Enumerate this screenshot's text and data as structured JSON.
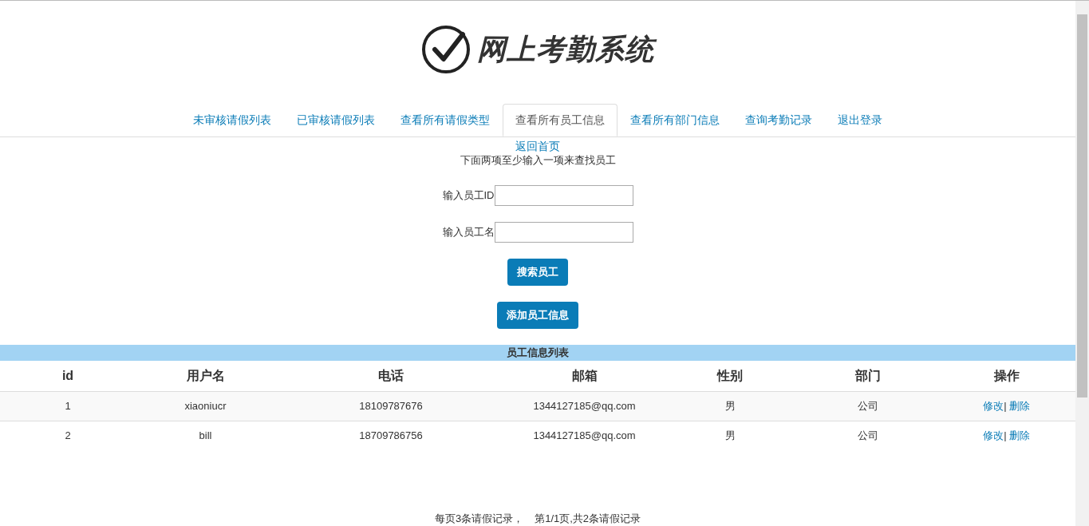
{
  "logo": {
    "title": "网上考勤系统"
  },
  "tabs": [
    {
      "label": "未审核请假列表",
      "selected": false
    },
    {
      "label": "已审核请假列表",
      "selected": false
    },
    {
      "label": "查看所有请假类型",
      "selected": false
    },
    {
      "label": "查看所有员工信息",
      "selected": true
    },
    {
      "label": "查看所有部门信息",
      "selected": false
    },
    {
      "label": "查询考勤记录",
      "selected": false
    },
    {
      "label": "退出登录",
      "selected": false
    }
  ],
  "back_link": "返回首页",
  "instruction": "下面两项至少输入一项来查找员工",
  "fields": [
    {
      "label": "输入员工ID"
    },
    {
      "label": "输入员工名"
    }
  ],
  "buttons": [
    "搜索员工",
    "添加员工信息"
  ],
  "table": {
    "title": "员工信息列表",
    "columns": [
      "id",
      "用户名",
      "电话",
      "邮箱",
      "性别",
      "部门",
      "操作"
    ],
    "rows": [
      {
        "cells": [
          "1",
          "xiaoniucr",
          "18109787676",
          "1344127185@qq.com",
          "男",
          "公司"
        ],
        "actions": [
          {
            "label": "修改",
            "kind": "link"
          },
          {
            "label": "|",
            "kind": "separator"
          },
          {
            "label": "删除",
            "kind": "link"
          }
        ]
      },
      {
        "cells": [
          "2",
          "bill",
          "18709786756",
          "1344127185@qq.com",
          "男",
          "公司"
        ],
        "actions": [
          {
            "label": "修改",
            "kind": "link"
          },
          {
            "label": "|",
            "kind": "separator"
          },
          {
            "label": "删除",
            "kind": "link"
          }
        ]
      }
    ]
  },
  "pagination": [
    "每页3条请假记录，",
    "第1/1页,共2条请假记录"
  ]
}
